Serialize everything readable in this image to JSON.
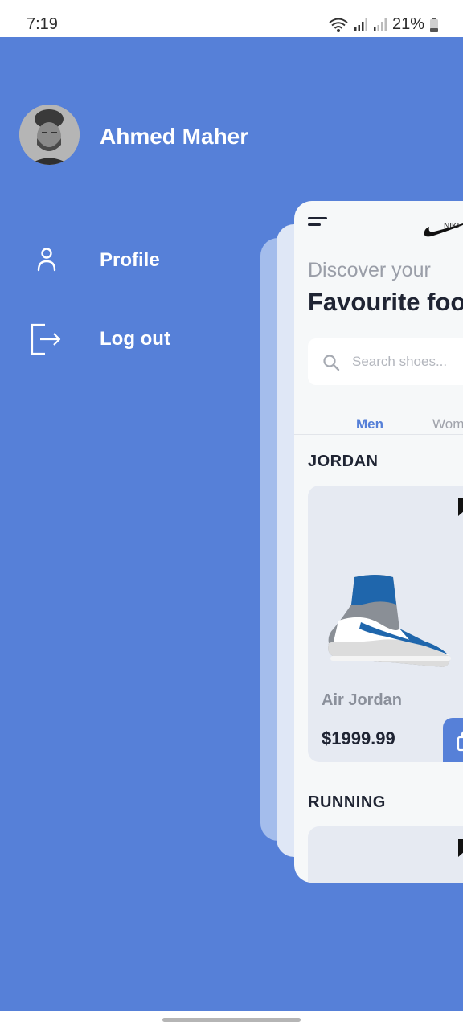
{
  "status_bar": {
    "time": "7:19",
    "battery_pct": "21%",
    "icons": [
      "wifi-icon",
      "signal-icon",
      "signal-icon",
      "battery-icon"
    ]
  },
  "drawer": {
    "user_name": "Ahmed Maher",
    "menu": [
      {
        "label": "Profile",
        "icon": "user-icon"
      },
      {
        "label": "Log out",
        "icon": "logout-icon"
      }
    ]
  },
  "app": {
    "brand": "NIKE",
    "discover": "Discover your",
    "headline": "Favourite foo",
    "search_placeholder": "Search shoes...",
    "tabs": [
      "Men",
      "Wom"
    ],
    "active_tab": "Men",
    "sections": [
      {
        "title": "JORDAN",
        "product": {
          "name": "Air Jordan",
          "price": "$1999.99"
        }
      },
      {
        "title": "RUNNING"
      }
    ]
  },
  "colors": {
    "accent": "#5680d8",
    "dark_text": "#1f2433",
    "muted_text": "#9a9ea8",
    "card_bg": "#e6eaf2"
  }
}
